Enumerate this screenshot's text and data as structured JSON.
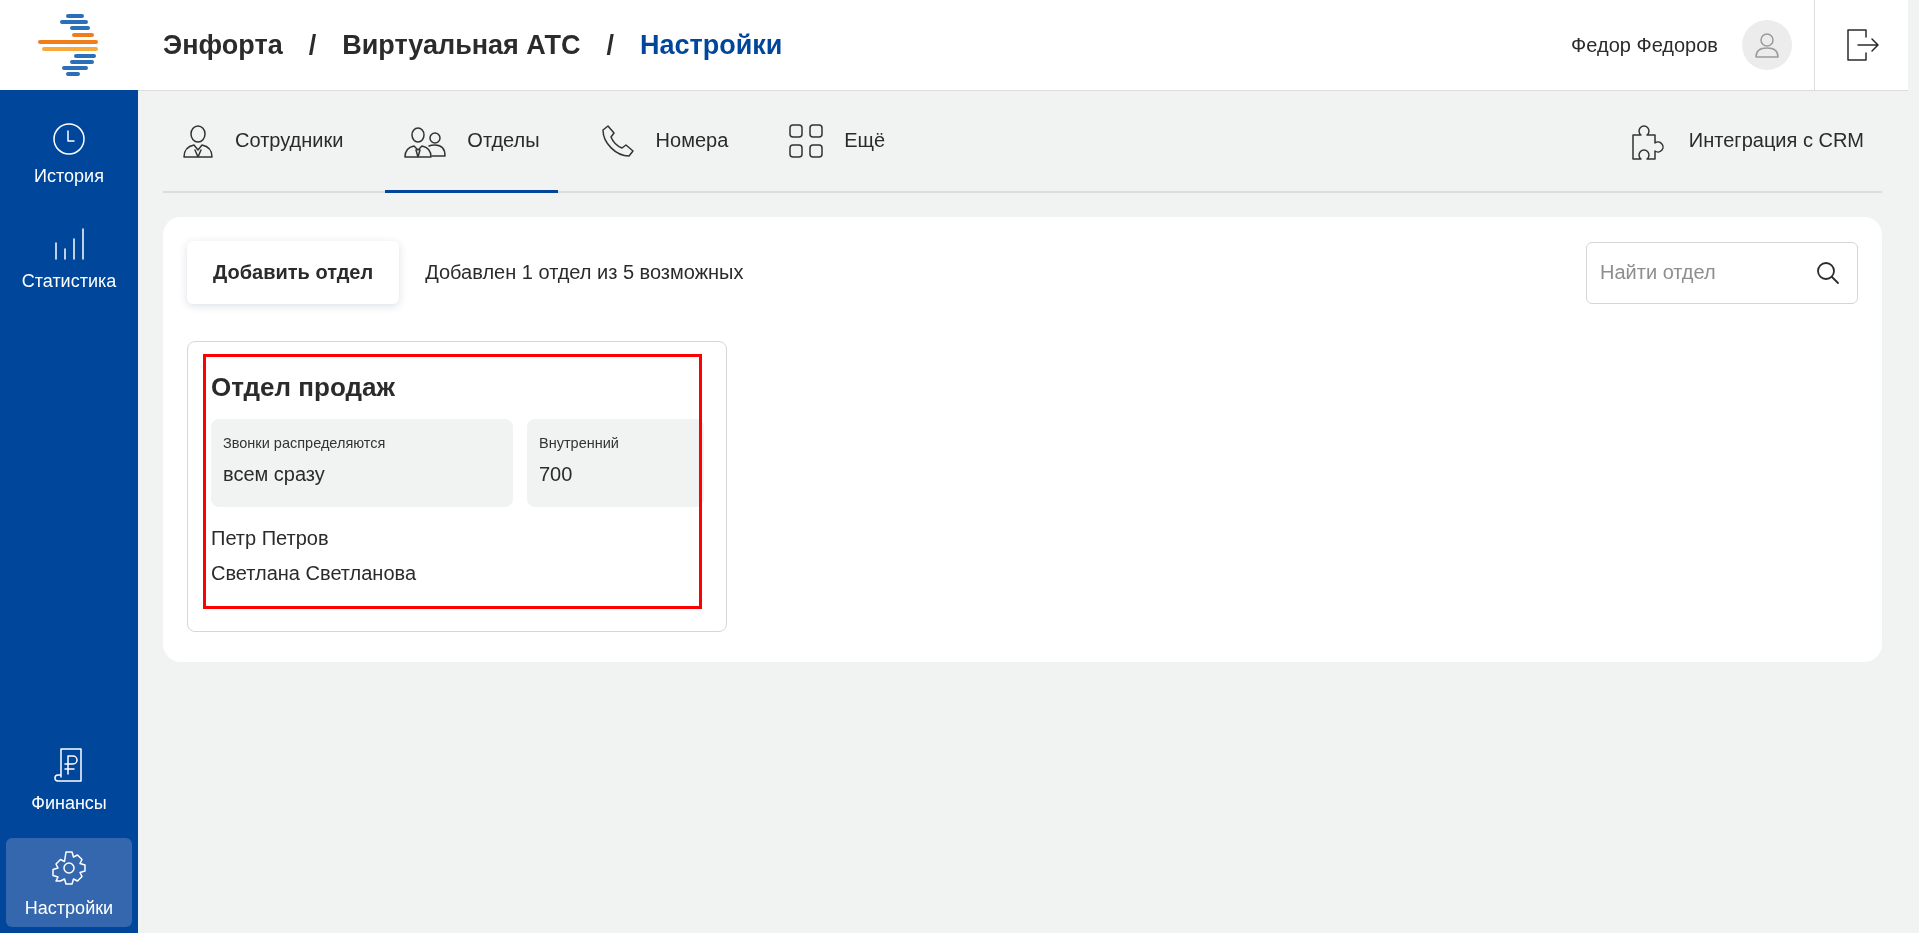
{
  "sidebar": {
    "top_items": [
      {
        "label": "История",
        "selected": false
      },
      {
        "label": "Статистика",
        "selected": false
      }
    ],
    "bottom_items": [
      {
        "label": "Финансы",
        "selected": false
      },
      {
        "label": "Настройки",
        "selected": true
      }
    ]
  },
  "header": {
    "breadcrumbs": [
      {
        "label": "Энфорта",
        "current": false
      },
      {
        "label": "Виртуальная АТС",
        "current": false
      },
      {
        "label": "Настройки",
        "current": true
      }
    ],
    "separator": "/",
    "user_name": "Федор Федоров"
  },
  "tabs": [
    {
      "label": "Сотрудники",
      "selected": false
    },
    {
      "label": "Отделы",
      "selected": true
    },
    {
      "label": "Номера",
      "selected": false
    },
    {
      "label": "Ещё",
      "selected": false
    }
  ],
  "integration_tab": {
    "label": "Интеграция с CRM",
    "selected": false
  },
  "toolbar": {
    "add_button": "Добавить отдел",
    "count_text": "Добавлен 1 отдел из 5 возможных",
    "search": {
      "placeholder": "Найти отдел"
    }
  },
  "departments": [
    {
      "name": "Отдел продаж",
      "highlighted": true,
      "fields": [
        {
          "label": "Звонки распределяются",
          "value": "всем сразу"
        },
        {
          "label": "Внутренний",
          "value": "700"
        }
      ],
      "members": [
        "Петр Петров",
        "Светлана Светланова"
      ]
    }
  ]
}
